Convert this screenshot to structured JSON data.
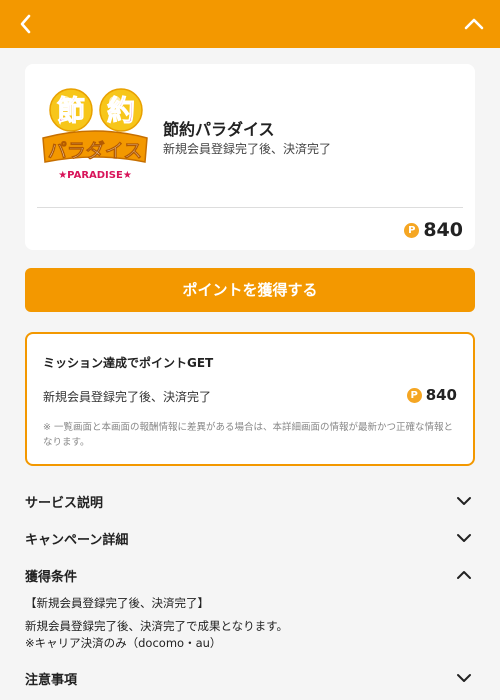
{
  "service": {
    "name": "節約パラダイス",
    "subtitle": "新規会員登録完了後、決済完了",
    "points": "840",
    "coin_symbol": "P",
    "logo": {
      "char1": "節",
      "char2": "約",
      "katakana": "パラダイス",
      "english": "★PARADISE★"
    }
  },
  "cta": {
    "label": "ポイントを獲得する"
  },
  "mission": {
    "title": "ミッション達成でポイントGET",
    "row_label": "新規会員登録完了後、決済完了",
    "row_points": "840",
    "note": "※ 一覧画面と本画面の報酬情報に差異がある場合は、本詳細画面の情報が最新かつ正確な情報となります。"
  },
  "sections": {
    "service_desc": "サービス説明",
    "campaign": "キャンペーン詳細",
    "acquisition": "獲得条件",
    "notes": "注意事項"
  },
  "acquisition_body": {
    "line1": "【新規会員登録完了後、決済完了】",
    "line2": "新規会員登録完了後、決済完了で成果となります。",
    "line3": "※キャリア決済のみ（docomo・au）"
  },
  "colors": {
    "accent": "#f39800",
    "coin": "#f5a623"
  }
}
